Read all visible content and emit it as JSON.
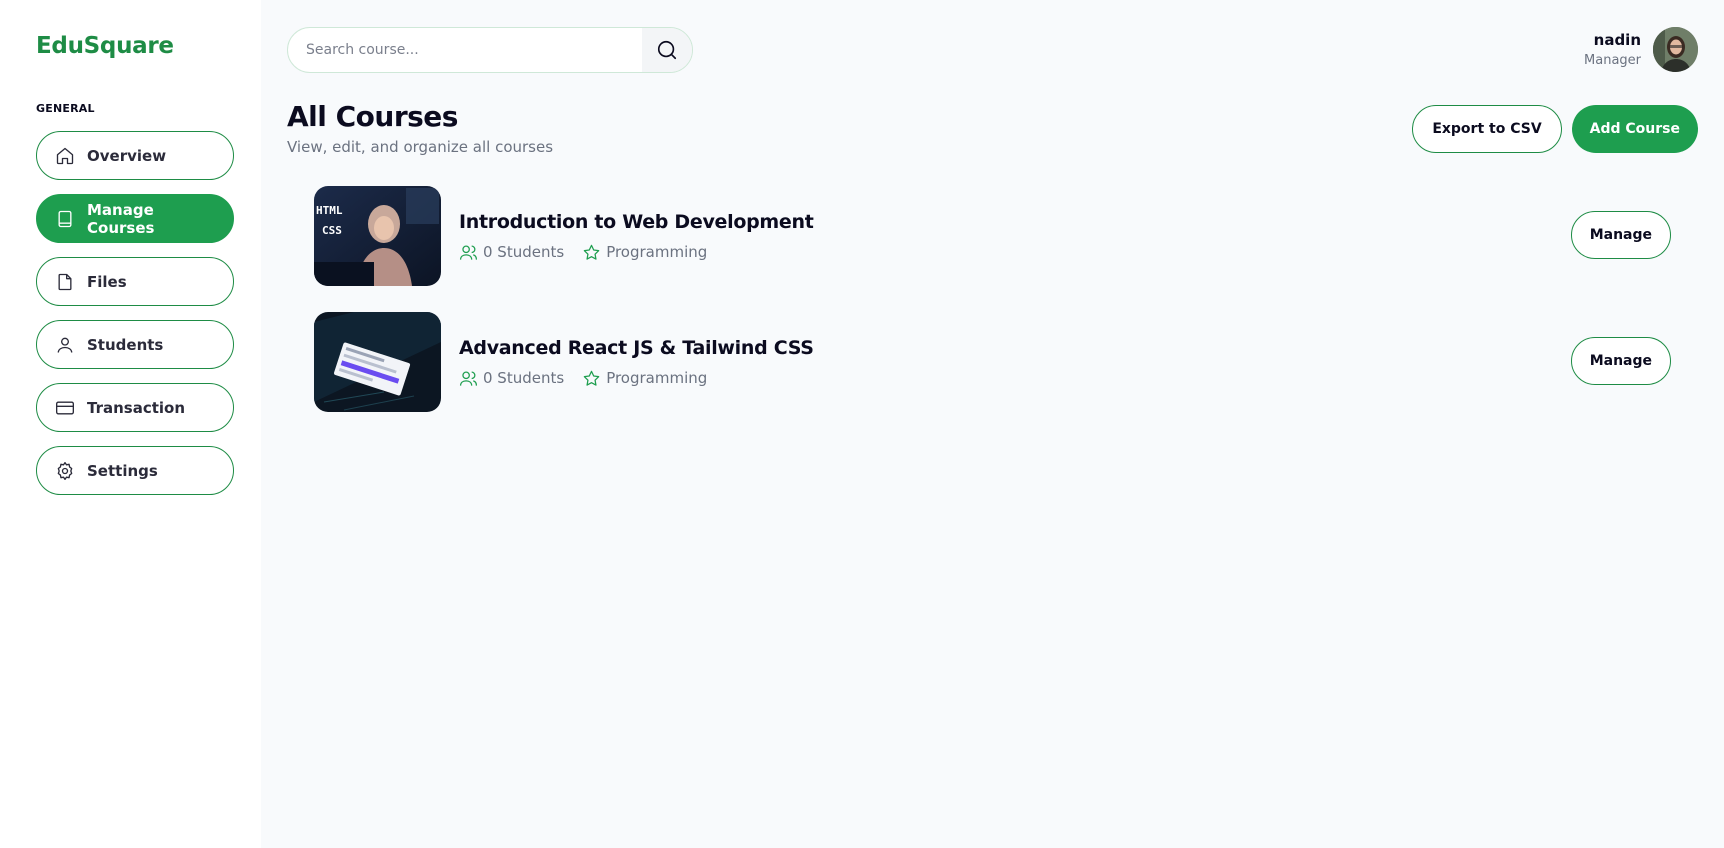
{
  "brand": {
    "name": "EduSquare",
    "color": "#1e8c45"
  },
  "sidebar": {
    "section_label": "GENERAL",
    "items": [
      {
        "label": "Overview",
        "icon": "home-icon",
        "active": false
      },
      {
        "label": "Manage Courses",
        "icon": "book-icon",
        "active": true
      },
      {
        "label": "Files",
        "icon": "file-icon",
        "active": false
      },
      {
        "label": "Students",
        "icon": "user-icon",
        "active": false
      },
      {
        "label": "Transaction",
        "icon": "credit-card-icon",
        "active": false
      },
      {
        "label": "Settings",
        "icon": "gear-icon",
        "active": false
      }
    ]
  },
  "search": {
    "placeholder": "Search course...",
    "value": "",
    "icon": "search-icon"
  },
  "user": {
    "name": "nadin",
    "role": "Manager"
  },
  "page": {
    "title": "All Courses",
    "subtitle": "View, edit, and organize all courses"
  },
  "actions": {
    "export_label": "Export to CSV",
    "add_label": "Add Course"
  },
  "courses": [
    {
      "title": "Introduction to Web Development",
      "students": "0 Students",
      "category": "Programming",
      "manage_label": "Manage",
      "thumb_text_1": "HTML",
      "thumb_text_2": "CSS"
    },
    {
      "title": "Advanced React JS & Tailwind CSS",
      "students": "0 Students",
      "category": "Programming",
      "manage_label": "Manage"
    }
  ],
  "colors": {
    "accent": "#1e9e4f",
    "text": "#0b0b1f",
    "muted": "#6b7280"
  }
}
